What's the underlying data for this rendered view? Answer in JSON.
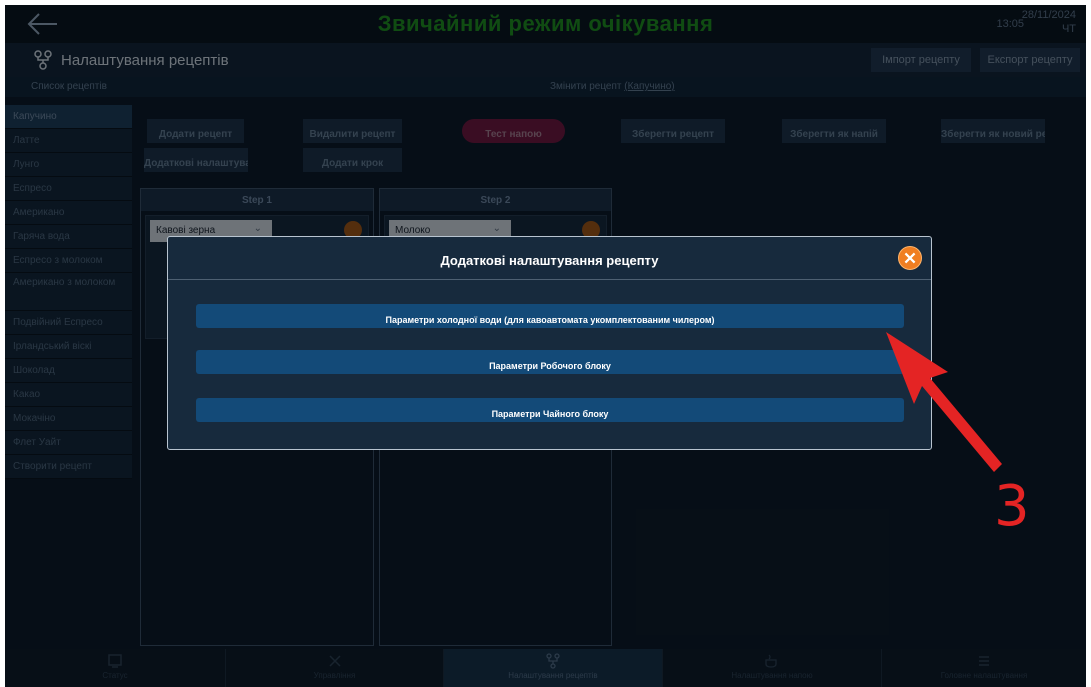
{
  "topbar": {
    "mode_title": "Звичайний режим очікування",
    "time": "13:05",
    "date": "28/11/2024",
    "day_of_week": "ЧТ"
  },
  "header": {
    "title": "Налаштування рецептів",
    "import_label": "Імпорт рецепту",
    "export_label": "Експорт рецепту"
  },
  "subheader": {
    "list_label": "Список рецептів",
    "edit_prefix": "Змінити рецепт ",
    "edit_recipe": "(Капучино)"
  },
  "sidebar": {
    "items": [
      {
        "label": "Капучино",
        "active": true
      },
      {
        "label": "Латте"
      },
      {
        "label": "Лунго"
      },
      {
        "label": "Еспресо"
      },
      {
        "label": "Американо"
      },
      {
        "label": "Гаряча вода"
      },
      {
        "label": "Еспресо з молоком"
      },
      {
        "label": "Американо з молоком"
      },
      {
        "label": "Подвійний Еспресо"
      },
      {
        "label": "Ірландський віскі"
      },
      {
        "label": "Шоколад"
      },
      {
        "label": "Какао"
      },
      {
        "label": "Мокачіно"
      },
      {
        "label": "Флет Уайт"
      },
      {
        "label": "Створити рецепт"
      }
    ]
  },
  "toolbar": {
    "add_recipe": "Додати рецепт",
    "delete_recipe": "Видалити рецепт",
    "test_drink": "Тест напою",
    "save_recipe": "Зберегти рецепт",
    "save_as_drink": "Зберегти як напій",
    "save_as_new": "Зберегти як новий ре",
    "extra_settings": "Додаткові налаштува",
    "add_step": "Додати крок"
  },
  "steps": [
    {
      "title": "Step 1",
      "ingredient": "Кавові зерна"
    },
    {
      "title": "Step 2",
      "ingredient": "Молоко"
    }
  ],
  "bottomnav": {
    "items": [
      {
        "label": "Статус",
        "icon": "status-icon"
      },
      {
        "label": "Управління",
        "icon": "tools-icon"
      },
      {
        "label": "Налаштування рецептів",
        "icon": "recipe-icon",
        "active": true
      },
      {
        "label": "Налаштування напою",
        "icon": "cup-icon"
      },
      {
        "label": "Головне налаштування",
        "icon": "list-icon"
      }
    ]
  },
  "dialog": {
    "title": "Додаткові налаштування рецепту",
    "buttons": [
      "Параметри холодної води (для кавоавтомата укомплектованим чилером)",
      "Параметри Робочого блоку",
      "Параметри Чайного блоку"
    ]
  },
  "annotation": {
    "number": "3",
    "color": "#e42424"
  }
}
